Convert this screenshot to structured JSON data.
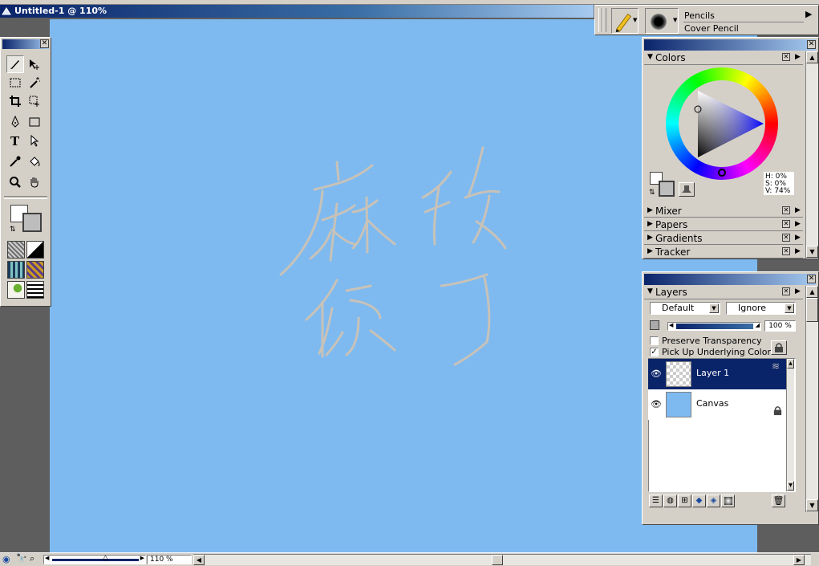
{
  "document": {
    "title": "Untitled-1 @ 110%"
  },
  "canvas": {
    "background_color": "#7ebaf0",
    "ink_color": "#c8c2b8"
  },
  "toolbox": {
    "tools": [
      "brush-icon",
      "layer-adjuster-icon",
      "rect-select-icon",
      "magic-wand-icon",
      "crop-icon",
      "transform-icon",
      "pen-icon",
      "rectangle-icon",
      "text-icon",
      "selection-arrow-icon",
      "dropper-icon",
      "paint-bucket-icon",
      "magnifier-icon",
      "grabber-icon"
    ]
  },
  "property_bar": {
    "category": "Pencils",
    "variant": "Cover Pencil"
  },
  "colors_panel": {
    "title": "Colors",
    "h_label": "H: 0%",
    "s_label": "S: 0%",
    "v_label": "V: 74%",
    "sections": [
      "Mixer",
      "Papers",
      "Gradients",
      "Tracker"
    ]
  },
  "layers_panel": {
    "title": "Layers",
    "composite_method": "Default",
    "depth_mode": "Ignore",
    "opacity": "100 %",
    "opacity_fraction": 1.0,
    "preserve_transparency_label": "Preserve Transparency",
    "pick_up_underlying_label": "Pick Up Underlying Color",
    "preserve_transparency_checked": false,
    "pick_up_underlying_checked": true,
    "layers": [
      {
        "name": "Layer 1",
        "selected": true
      },
      {
        "name": "Canvas",
        "selected": false
      }
    ]
  },
  "status_bar": {
    "zoom": "110 %"
  }
}
